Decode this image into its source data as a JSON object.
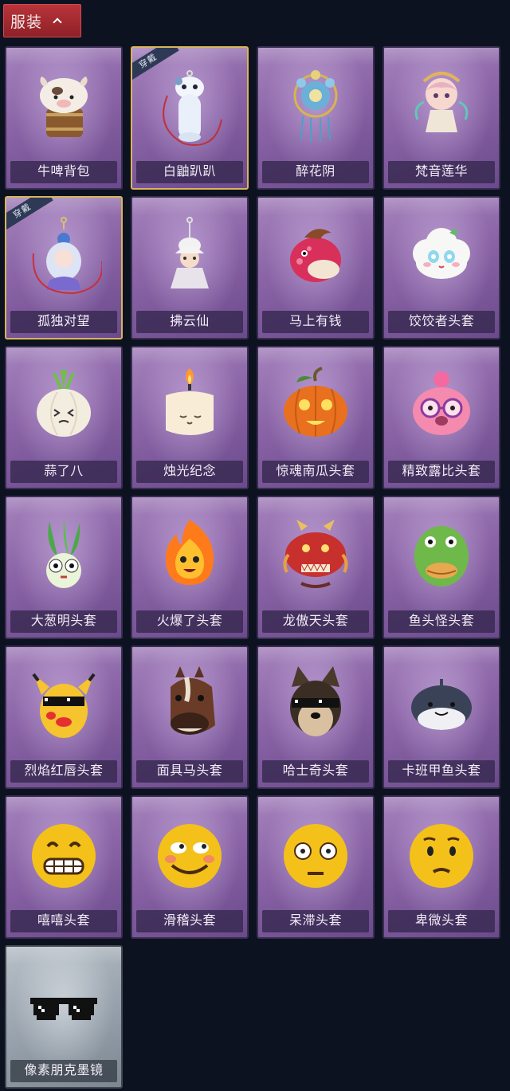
{
  "section": {
    "title": "服装",
    "toggle_icon": "chevron-up-icon"
  },
  "equipped_badge": "穿戴",
  "items": [
    {
      "name": "牛啤背包",
      "icon": "cow-beer-backpack-icon",
      "equipped": false
    },
    {
      "name": "白鼬趴趴",
      "icon": "white-ferret-icon",
      "equipped": true
    },
    {
      "name": "醉花阴",
      "icon": "flower-ornament-icon",
      "equipped": false
    },
    {
      "name": "梵音莲华",
      "icon": "lotus-doll-icon",
      "equipped": false
    },
    {
      "name": "孤独对望",
      "icon": "lonely-gaze-doll-icon",
      "equipped": true
    },
    {
      "name": "拂云仙",
      "icon": "cloud-immortal-pendant-icon",
      "equipped": false
    },
    {
      "name": "马上有钱",
      "icon": "red-horse-head-icon",
      "equipped": false
    },
    {
      "name": "饺饺者头套",
      "icon": "dumpling-head-icon",
      "equipped": false
    },
    {
      "name": "蒜了八",
      "icon": "garlic-head-icon",
      "equipped": false
    },
    {
      "name": "烛光纪念",
      "icon": "candle-head-icon",
      "equipped": false
    },
    {
      "name": "惊魂南瓜头套",
      "icon": "pumpkin-head-icon",
      "equipped": false
    },
    {
      "name": "精致露比头套",
      "icon": "pink-glasses-head-icon",
      "equipped": false
    },
    {
      "name": "大葱明头套",
      "icon": "scallion-head-icon",
      "equipped": false
    },
    {
      "name": "火爆了头套",
      "icon": "fire-head-icon",
      "equipped": false
    },
    {
      "name": "龙傲天头套",
      "icon": "dragon-head-icon",
      "equipped": false
    },
    {
      "name": "鱼头怪头套",
      "icon": "fish-head-icon",
      "equipped": false
    },
    {
      "name": "烈焰红唇头套",
      "icon": "yellow-mouse-head-icon",
      "equipped": false
    },
    {
      "name": "面具马头套",
      "icon": "horse-mask-icon",
      "equipped": false
    },
    {
      "name": "哈士奇头套",
      "icon": "husky-head-icon",
      "equipped": false
    },
    {
      "name": "卡班甲鱼头套",
      "icon": "round-fish-head-icon",
      "equipped": false
    },
    {
      "name": "嘻嘻头套",
      "icon": "grin-emoji-head-icon",
      "equipped": false
    },
    {
      "name": "滑稽头套",
      "icon": "funny-emoji-head-icon",
      "equipped": false
    },
    {
      "name": "呆滞头套",
      "icon": "blank-stare-emoji-head-icon",
      "equipped": false
    },
    {
      "name": "卑微头套",
      "icon": "humble-emoji-head-icon",
      "equipped": false
    },
    {
      "name": "像素朋克墨镜",
      "icon": "pixel-sunglasses-icon",
      "equipped": false,
      "rarity": "gray"
    }
  ]
}
